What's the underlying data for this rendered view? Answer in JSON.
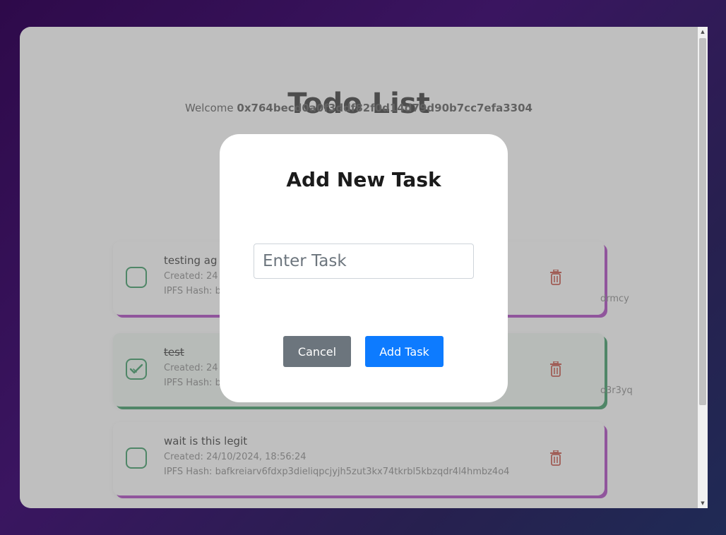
{
  "app": {
    "title": "Todo List",
    "welcome_prefix": "Welcome ",
    "wallet_address": "0x764becd0a0f3ddf82f0d14d79d90b7cc7efa3304"
  },
  "tasks": [
    {
      "name": "testing ag",
      "created": "Created: 24",
      "ipfs": "IPFS Hash: b",
      "ipfs_tail": "drmcy",
      "completed": false
    },
    {
      "name": "test",
      "created": "Created: 24",
      "ipfs": "IPFS Hash: b",
      "ipfs_tail": "o3r3yq",
      "completed": true
    },
    {
      "name": "wait is this legit",
      "created": "Created: 24/10/2024, 18:56:24",
      "ipfs": "IPFS Hash: bafkreiarv6fdxp3dieliqpcjyjh5zut3kx74tkrbl5kbzqdr4l4hmbz4o4",
      "ipfs_tail": "",
      "completed": false
    }
  ],
  "modal": {
    "title": "Add New Task",
    "input_placeholder": "Enter Task",
    "input_value": "",
    "cancel_label": "Cancel",
    "add_label": "Add Task"
  },
  "icons": {
    "checkbox": "checkbox-icon",
    "check": "check-icon",
    "trash": "trash-icon"
  },
  "colors": {
    "primary": "#0d7bff",
    "secondary": "#6c757d",
    "success": "#1e8c4e",
    "danger": "#c0392b",
    "accent_shadow": "#a12bb8"
  }
}
